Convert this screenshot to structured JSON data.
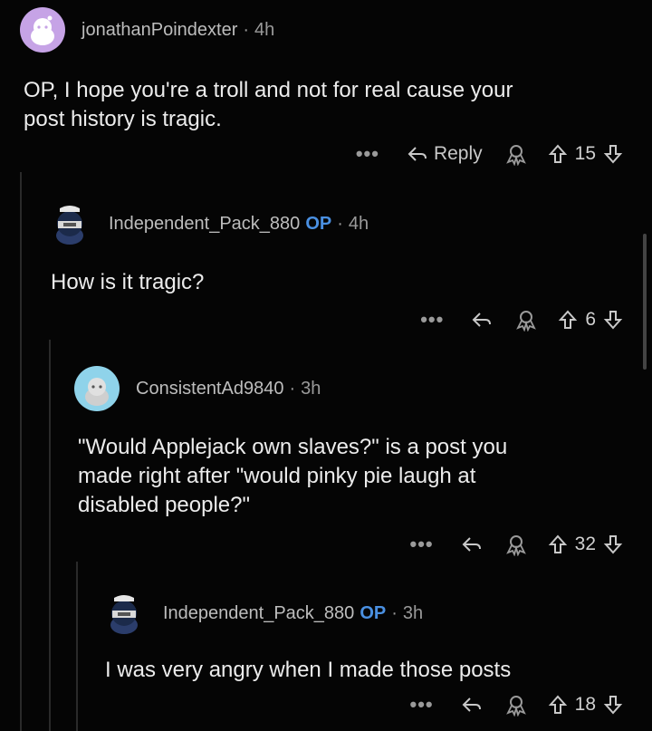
{
  "comments": [
    {
      "username": "jonathanPoindexter",
      "op": "",
      "separator": "·",
      "time": "4h",
      "body": [
        "OP, I hope you're a troll and not for real cause your",
        "post history is tragic."
      ],
      "reply_label": "Reply",
      "votes": "15",
      "avatar_color": "#c6a3e6"
    },
    {
      "username": "Independent_Pack_880",
      "op": "OP",
      "separator": "·",
      "time": "4h",
      "body": [
        "How is it tragic?"
      ],
      "reply_label": "",
      "votes": "6",
      "avatar_color": "#1b2a4a"
    },
    {
      "username": "ConsistentAd9840",
      "op": "",
      "separator": "·",
      "time": "3h",
      "body": [
        "\"Would Applejack own slaves?\" is a post you",
        "made right after \"would pinky pie laugh at",
        "disabled people?\""
      ],
      "reply_label": "",
      "votes": "32",
      "avatar_color": "#8fd3ea"
    },
    {
      "username": "Independent_Pack_880",
      "op": "OP",
      "separator": "·",
      "time": "3h",
      "body": [
        "I was very angry when I made those posts"
      ],
      "reply_label": "",
      "votes": "18",
      "avatar_color": "#1b2a4a"
    }
  ],
  "more_label": "•••",
  "colors": {
    "background": "#050505",
    "op_blue": "#4a90e2",
    "muted": "#9a9a9a"
  },
  "icons": [
    "reply-arrow-icon",
    "award-icon",
    "upvote-icon",
    "downvote-icon",
    "more-icon"
  ]
}
